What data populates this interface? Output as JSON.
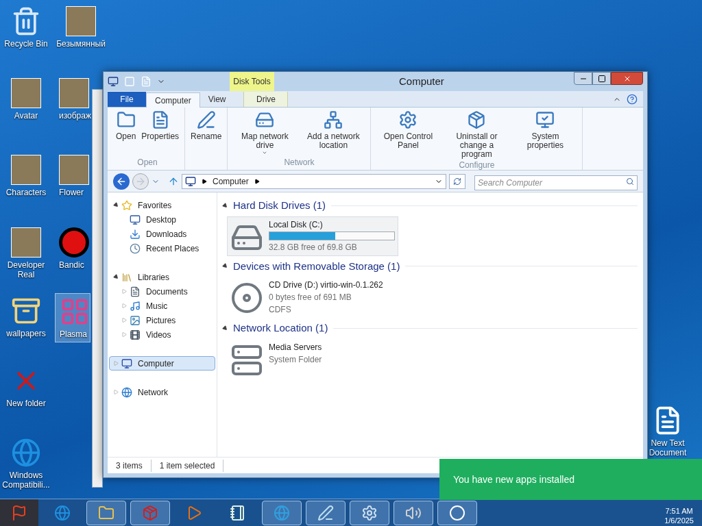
{
  "desktop_icons": [
    {
      "label": "Recycle Bin",
      "kind": "recycle",
      "selected": false
    },
    {
      "label": "Безымянный",
      "kind": "photo",
      "selected": false
    },
    {
      "label": "Avatar",
      "kind": "photo",
      "selected": false
    },
    {
      "label": "изображ",
      "kind": "photo",
      "selected": false
    },
    {
      "label": "Characters",
      "kind": "photo",
      "selected": false
    },
    {
      "label": "Flower",
      "kind": "photo",
      "selected": false
    },
    {
      "label": "Developer Real",
      "kind": "photo",
      "selected": false
    },
    {
      "label": "Bandic",
      "kind": "record",
      "selected": false
    },
    {
      "label": "wallpapers",
      "kind": "zip",
      "selected": false
    },
    {
      "label": "Plasma",
      "kind": "app",
      "selected": true
    },
    {
      "label": "New folder",
      "kind": "cross",
      "selected": false
    },
    {
      "label": "Windows Compatibili...",
      "kind": "ie",
      "selected": false
    },
    {
      "label": "New Text Document",
      "kind": "text",
      "selected": false
    }
  ],
  "window": {
    "title": "Computer",
    "context_tab_group": "Disk Tools",
    "tabs": [
      {
        "label": "File",
        "kind": "file",
        "selected": false
      },
      {
        "label": "Computer",
        "kind": "tab",
        "selected": true
      },
      {
        "label": "View",
        "kind": "tab",
        "selected": false
      },
      {
        "label": "Drive",
        "kind": "context",
        "selected": false
      }
    ],
    "ribbon_groups": [
      {
        "label": "Open",
        "items": [
          {
            "label": "Open"
          },
          {
            "label": "Properties"
          }
        ]
      },
      {
        "items": [
          {
            "label": "Rename"
          }
        ]
      },
      {
        "label": "Network",
        "items": [
          {
            "label": "Map network drive",
            "dropdown": true
          },
          {
            "label": "Add a network location",
            "dropdown": false
          }
        ]
      },
      {
        "label": "Configure",
        "items": [
          {
            "label": "Open Control Panel"
          },
          {
            "label": "Uninstall or change a program"
          },
          {
            "label": "System properties"
          }
        ]
      }
    ],
    "address": {
      "crumbs": [
        "Computer"
      ]
    },
    "search": {
      "placeholder": "Search Computer"
    },
    "nav_tree": [
      {
        "label": "Favorites",
        "kind": "star",
        "expanded": true,
        "selected": false,
        "children": [
          {
            "label": "Desktop",
            "kind": "desktop",
            "selected": false
          },
          {
            "label": "Downloads",
            "kind": "downloads",
            "selected": false
          },
          {
            "label": "Recent Places",
            "kind": "recent",
            "selected": false
          }
        ]
      },
      {
        "label": "Libraries",
        "kind": "libraries",
        "expanded": true,
        "selected": false,
        "children": [
          {
            "label": "Documents",
            "kind": "documents",
            "expanded": false,
            "selected": false
          },
          {
            "label": "Music",
            "kind": "music",
            "expanded": false,
            "selected": false
          },
          {
            "label": "Pictures",
            "kind": "pictures",
            "expanded": false,
            "selected": false
          },
          {
            "label": "Videos",
            "kind": "videos",
            "expanded": false,
            "selected": false
          }
        ]
      },
      {
        "label": "Computer",
        "kind": "computer",
        "expanded": false,
        "selected": true
      },
      {
        "label": "Network",
        "kind": "network",
        "expanded": false,
        "selected": false
      }
    ],
    "sections": [
      {
        "title": "Hard Disk Drives (1)",
        "expanded": true,
        "items": [
          {
            "name": "Local Disk (C:)",
            "kind": "disk",
            "selected": true,
            "level": 0.53,
            "details": [
              "32.8 GB free of 69.8 GB"
            ]
          }
        ]
      },
      {
        "title": "Devices with Removable Storage (1)",
        "expanded": true,
        "items": [
          {
            "name": "CD Drive (D:) virtio-win-0.1.262",
            "kind": "cd",
            "selected": false,
            "details": [
              "0 bytes free of 691 MB",
              "CDFS"
            ]
          }
        ]
      },
      {
        "title": "Network Location (1)",
        "expanded": true,
        "items": [
          {
            "name": "Media Servers",
            "kind": "server",
            "selected": false,
            "details": [
              "System Folder"
            ]
          }
        ]
      }
    ],
    "status_bar": [
      "3 items",
      "1 item selected"
    ]
  },
  "notification": {
    "text": "You have new apps installed"
  },
  "taskbar": {
    "items": [
      {
        "kind": "ie",
        "running": false
      },
      {
        "kind": "explorer",
        "running": true
      },
      {
        "kind": "red",
        "running": true
      },
      {
        "kind": "media",
        "running": false
      },
      {
        "kind": "pad",
        "running": false
      },
      {
        "kind": "globe",
        "running": true
      },
      {
        "kind": "note",
        "running": true
      },
      {
        "kind": "panel",
        "running": true
      },
      {
        "kind": "speaker",
        "running": true
      },
      {
        "kind": "circle",
        "running": true
      }
    ],
    "clock": {
      "time": "7:51 AM",
      "date": "1/6/2025"
    }
  }
}
